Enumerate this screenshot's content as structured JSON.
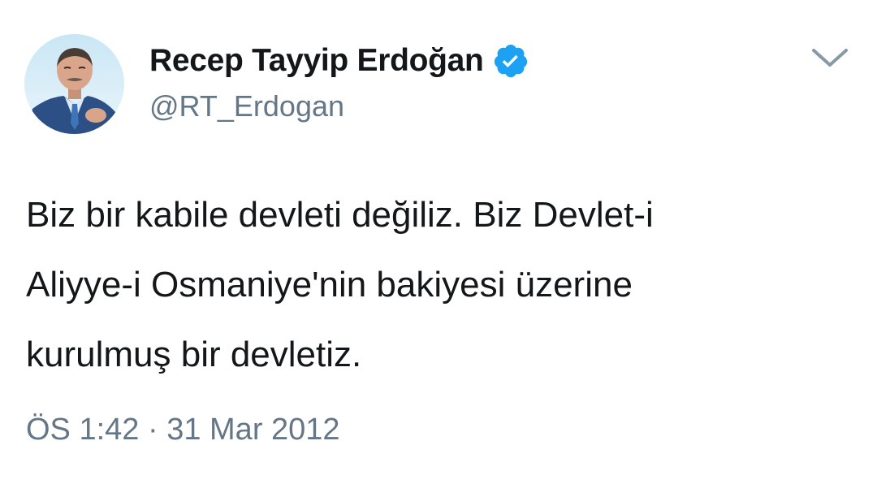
{
  "user": {
    "display_name": "Recep Tayyip Erdoğan",
    "handle": "@RT_Erdogan",
    "verified": true,
    "avatar_icon": "profile-photo"
  },
  "tweet": {
    "text": "Biz bir kabile devleti değiliz. Biz Devlet-i\nAliyye-i Osmaniye'nin bakiyesi üzerine\nkurulmuş bir devletiz.",
    "time": "ÖS 1:42",
    "separator": "·",
    "date": "31 Mar 2012"
  },
  "icons": {
    "verified": "verified-badge-icon",
    "menu": "chevron-down-icon"
  },
  "colors": {
    "text": "#14171a",
    "secondary": "#657786",
    "verified_blue": "#1da1f2"
  }
}
